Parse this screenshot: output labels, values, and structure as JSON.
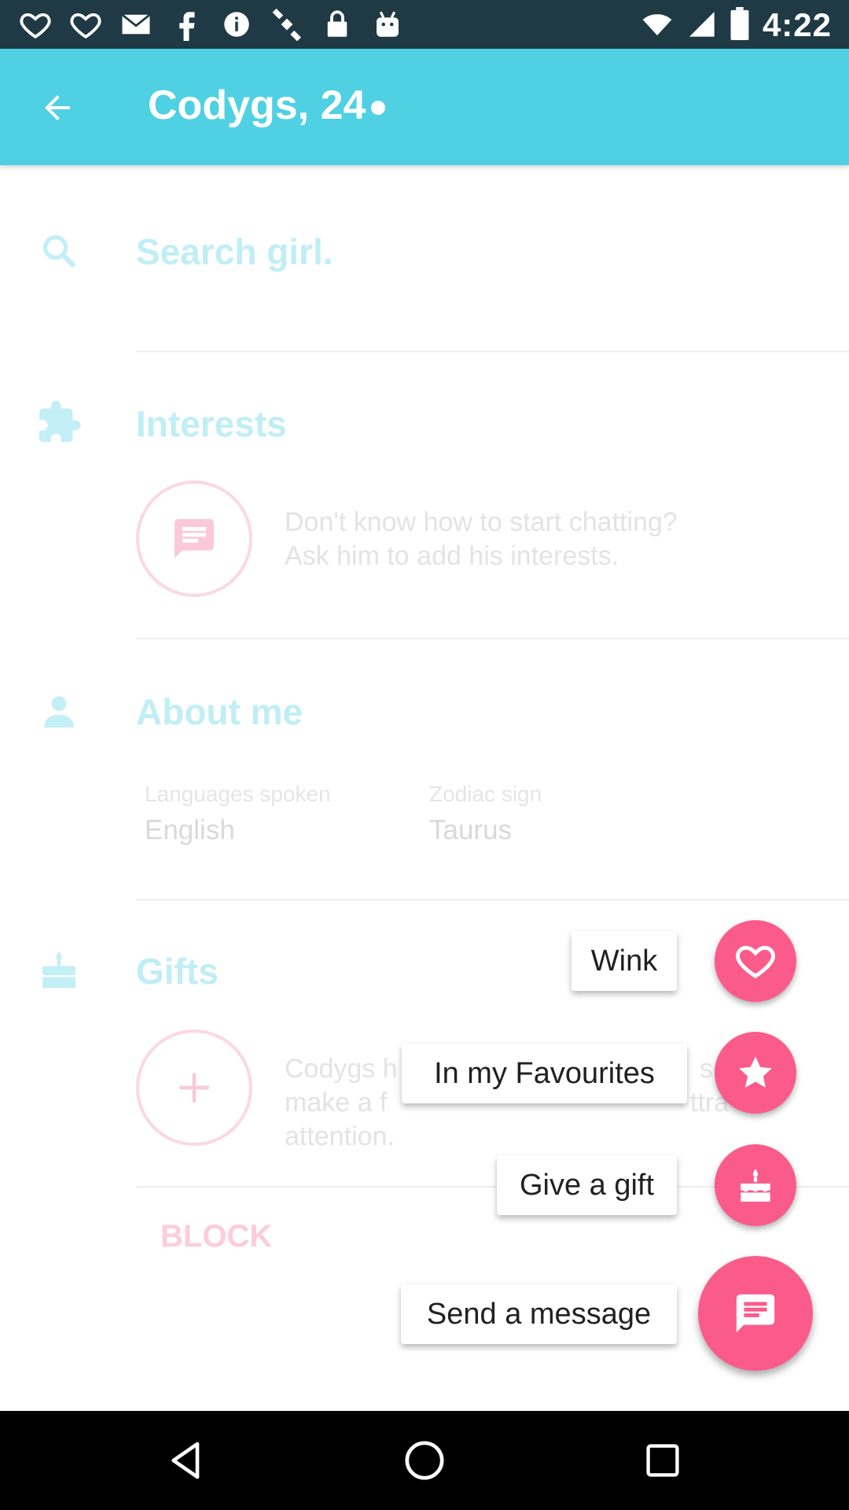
{
  "status_bar": {
    "time": "4:22",
    "icons": [
      "heart-notification-icon",
      "heart-notification-icon",
      "mail-icon",
      "facebook-icon",
      "info-icon",
      "satellite-icon",
      "lock-icon",
      "android-icon",
      "wifi-icon",
      "signal-icon",
      "battery-icon"
    ]
  },
  "app_bar": {
    "title": "Codygs, 24",
    "back_icon": "arrow-back-icon",
    "color": "#4fd0e3"
  },
  "sections": {
    "search": {
      "icon": "search-icon",
      "title": "Search girl."
    },
    "interests": {
      "icon": "puzzle-icon",
      "title": "Interests",
      "text_line1": "Don't know how to start chatting?",
      "text_line2": "Ask him to add his interests."
    },
    "about": {
      "icon": "person-icon",
      "title": "About me",
      "languages_label": "Languages spoken",
      "languages_value": "English",
      "zodiac_label": "Zodiac sign",
      "zodiac_value": "Taurus"
    },
    "gifts": {
      "icon": "cake-icon",
      "title": "Gifts",
      "text_line1": "Codygs h",
      "text_line1_tail": "s ye",
      "text_line2": "make a f",
      "text_line2_tail": "ttra",
      "text_line3": "attention."
    }
  },
  "block_label": "BLOCK",
  "fab_menu": {
    "wink": {
      "label": "Wink",
      "icon": "heart-outline-icon"
    },
    "favourites": {
      "label": "In my Favourites",
      "icon": "star-icon"
    },
    "gift": {
      "label": "Give a gift",
      "icon": "cake-icon"
    },
    "message": {
      "label": "Send a message",
      "icon": "chat-icon"
    }
  },
  "colors": {
    "accent_pink": "#fb5b8b",
    "primary_cyan": "#4fd0e3",
    "status_bar": "#1f3a45"
  },
  "nav_bar": {
    "back": "back-triangle-icon",
    "home": "home-circle-icon",
    "recents": "recents-square-icon"
  }
}
